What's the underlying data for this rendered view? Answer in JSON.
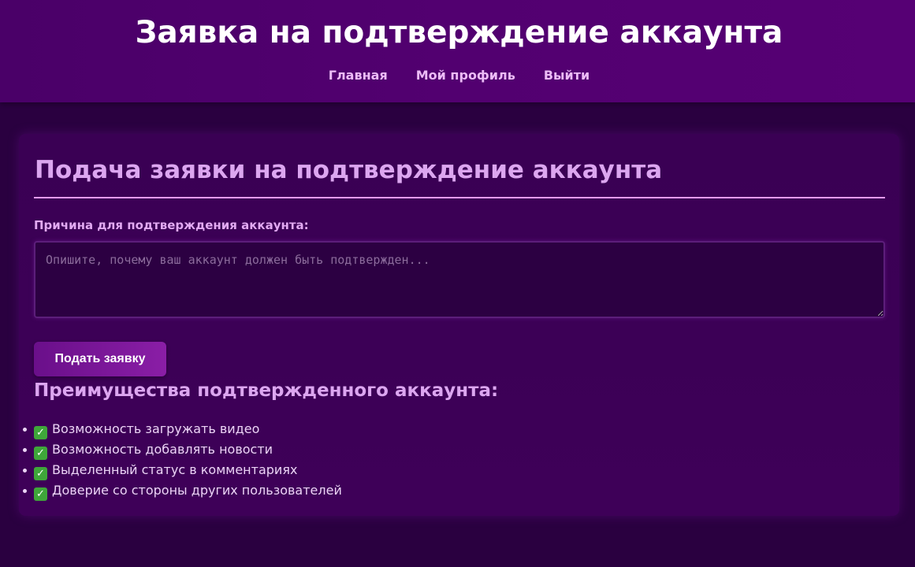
{
  "header": {
    "title": "Заявка на подтверждение аккаунта",
    "nav": [
      {
        "label": "Главная"
      },
      {
        "label": "Мой профиль"
      },
      {
        "label": "Выйти"
      }
    ]
  },
  "form": {
    "title": "Подача заявки на подтверждение аккаунта",
    "reason_label": "Причина для подтверждения аккаунта:",
    "reason_value": "",
    "reason_placeholder": "Опишите, почему ваш аккаунт должен быть подтвержден...",
    "submit_label": "Подать заявку"
  },
  "benefits": {
    "title": "Преимущества подтвержденного аккаунта:",
    "icon": "check-mark-icon",
    "items": [
      "Возможность загружать видео",
      "Возможность добавлять новости",
      "Выделенный статус в комментариях",
      "Доверие со стороны других пользователей"
    ]
  },
  "colors": {
    "page_background": "#2a0040",
    "header_background": "#520070",
    "accent": "#dca6f0",
    "button": "#7a169a",
    "check": "#3fa63a"
  }
}
